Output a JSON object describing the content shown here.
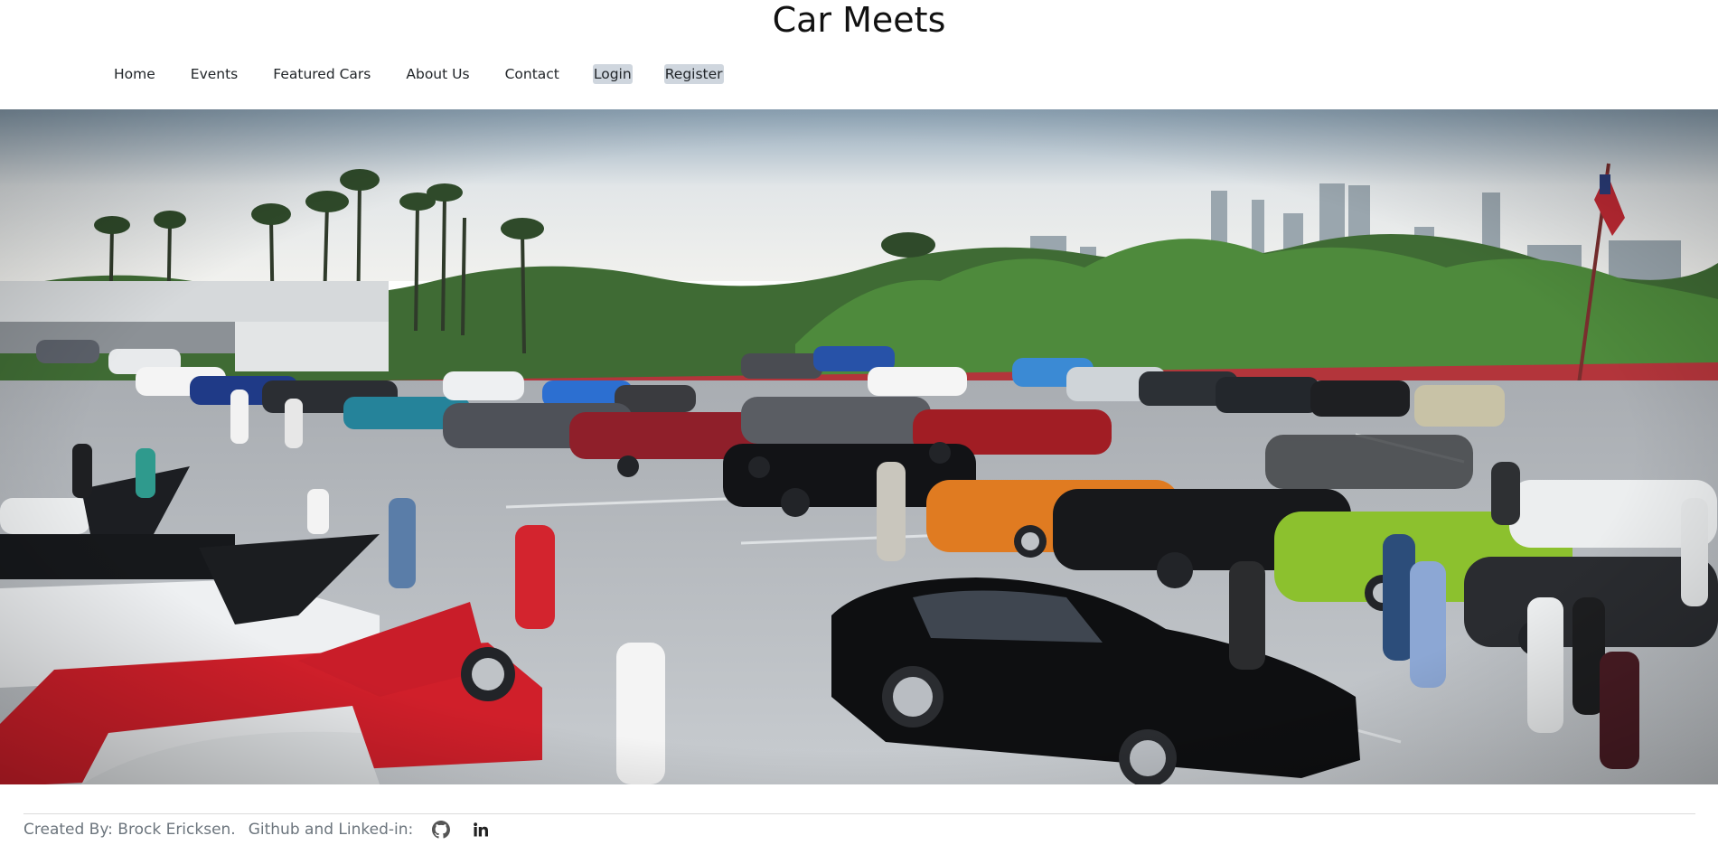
{
  "header": {
    "title": "Car Meets"
  },
  "nav": {
    "items": [
      {
        "label": "Home"
      },
      {
        "label": "Events"
      },
      {
        "label": "Featured Cars"
      },
      {
        "label": "About Us"
      },
      {
        "label": "Contact"
      },
      {
        "label": "Login"
      },
      {
        "label": "Register"
      }
    ]
  },
  "hero": {
    "icon": "car-meet-parking-lot-photo"
  },
  "footer": {
    "credit": "Created By: Brock Ericksen.",
    "links_label": "Github and Linked-in:",
    "github_icon": "github-icon",
    "linkedin_icon": "linkedin-icon"
  },
  "colors": {
    "nav_auth_highlight": "#cfd6de",
    "text_dark": "#212529",
    "footer_text": "#6c757d"
  }
}
